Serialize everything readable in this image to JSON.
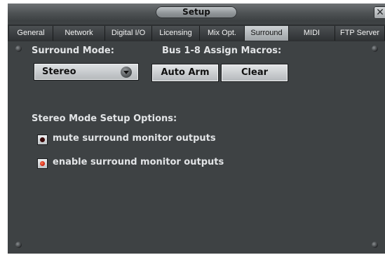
{
  "window": {
    "title": "Setup",
    "close_glyph": "✕"
  },
  "tabs": [
    {
      "label": "General"
    },
    {
      "label": "Network"
    },
    {
      "label": "Digital I/O"
    },
    {
      "label": "Licensing"
    },
    {
      "label": "Mix Opt."
    },
    {
      "label": "Surround"
    },
    {
      "label": "MIDI"
    },
    {
      "label": "FTP Server"
    }
  ],
  "active_tab": "Surround",
  "surround": {
    "mode_label": "Surround Mode:",
    "mode_value": "Stereo",
    "bus_label": "Bus 1-8 Assign Macros:",
    "auto_arm_label": "Auto Arm",
    "clear_label": "Clear"
  },
  "stereo_options": {
    "heading": "Stereo Mode Setup Options:",
    "mute_label": "mute surround monitor outputs",
    "mute_checked": false,
    "enable_label": "enable surround monitor outputs",
    "enable_checked": true
  },
  "colors": {
    "panel_bg": "#3e4244",
    "accent_on": "#e0341a"
  }
}
